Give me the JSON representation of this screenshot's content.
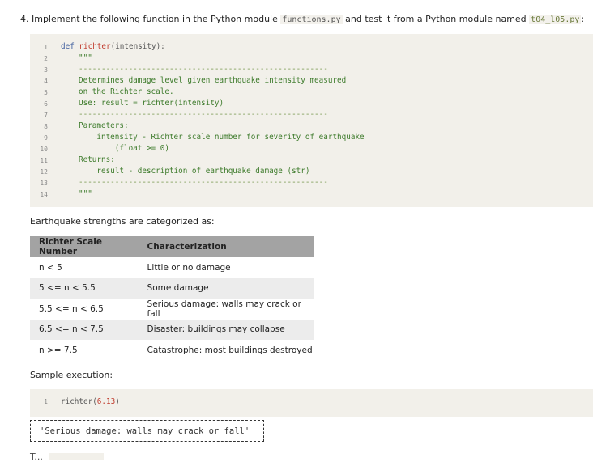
{
  "task": {
    "prefix": "4. Implement the following function in the Python module",
    "module": "functions.py",
    "middle": "and test it from a Python module named",
    "test_module": "t04_l05.py",
    "suffix": ":"
  },
  "code": {
    "line_numbers": [
      "1",
      "2",
      "3",
      "4",
      "5",
      "6",
      "7",
      "8",
      "9",
      "10",
      "11",
      "12",
      "13",
      "14"
    ],
    "def_kw": "def",
    "func_name": "richter",
    "signature": "(intensity):",
    "lines": [
      "\"\"\"",
      "-------------------------------------------------------",
      "Determines damage level given earthquake intensity measured",
      "on the Richter scale.",
      "Use: result = richter(intensity)",
      "-------------------------------------------------------",
      "Parameters:",
      "    intensity - Richter scale number for severity of earthquake",
      "        (float >= 0)",
      "Returns:",
      "    result - description of earthquake damage (str)",
      "-------------------------------------------------------",
      "\"\"\""
    ]
  },
  "categorized_text": "Earthquake strengths are categorized as:",
  "table": {
    "headers": [
      "Richter Scale Number",
      "Characterization"
    ],
    "rows": [
      [
        "n < 5",
        "Little or no damage"
      ],
      [
        "5 <= n < 5.5",
        "Some damage"
      ],
      [
        "5.5 <= n < 6.5",
        "Serious damage: walls may crack or fall"
      ],
      [
        "6.5 <= n < 7.5",
        "Disaster: buildings may collapse"
      ],
      [
        "n >= 7.5",
        "Catastrophe: most buildings destroyed"
      ]
    ]
  },
  "sample_label": "Sample execution:",
  "sample": {
    "line_number": "1",
    "call_name": "richter",
    "call_open": "(",
    "call_arg": "6.13",
    "call_close": ")"
  },
  "output_text": "'Serious damage: walls may crack or fall'",
  "cut_text": "T..."
}
